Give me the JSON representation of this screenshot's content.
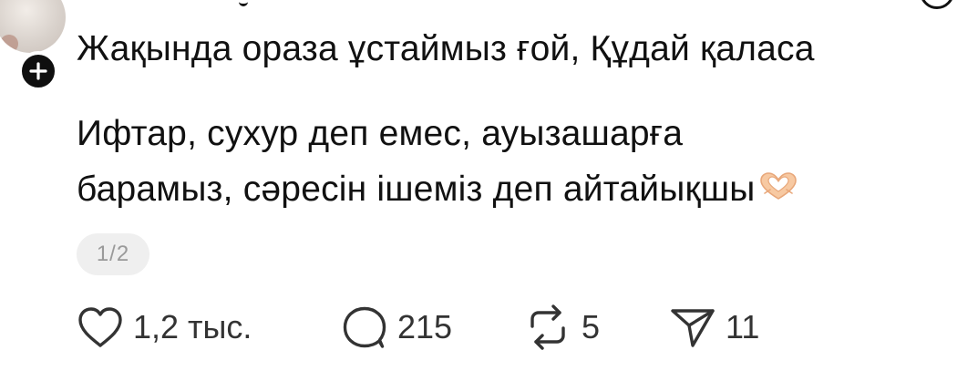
{
  "post": {
    "text_line_1": "Жақында ораза ұстаймыз ғой, Құдай қаласа",
    "text_line_2": "Ифтар, сухур деп емес, ауызашарға",
    "text_line_3": "барамыз, сәресін ішеміз деп айтайықшы",
    "text_emoji": "heart-hands-emoji",
    "pager": "1/2"
  },
  "actions": {
    "like_count": "1,2 тыс.",
    "comment_count": "215",
    "repost_count": "5",
    "share_count": "11"
  },
  "icons": {
    "follow": "plus-icon",
    "like": "heart-icon",
    "comment": "comment-bubble-icon",
    "repost": "repost-arrows-icon",
    "share": "send-icon"
  },
  "colors": {
    "text": "#111111",
    "action_text": "#333333",
    "pager_bg": "#efefef",
    "pager_text": "#9a9a9a",
    "badge": "#0f0f0f"
  }
}
